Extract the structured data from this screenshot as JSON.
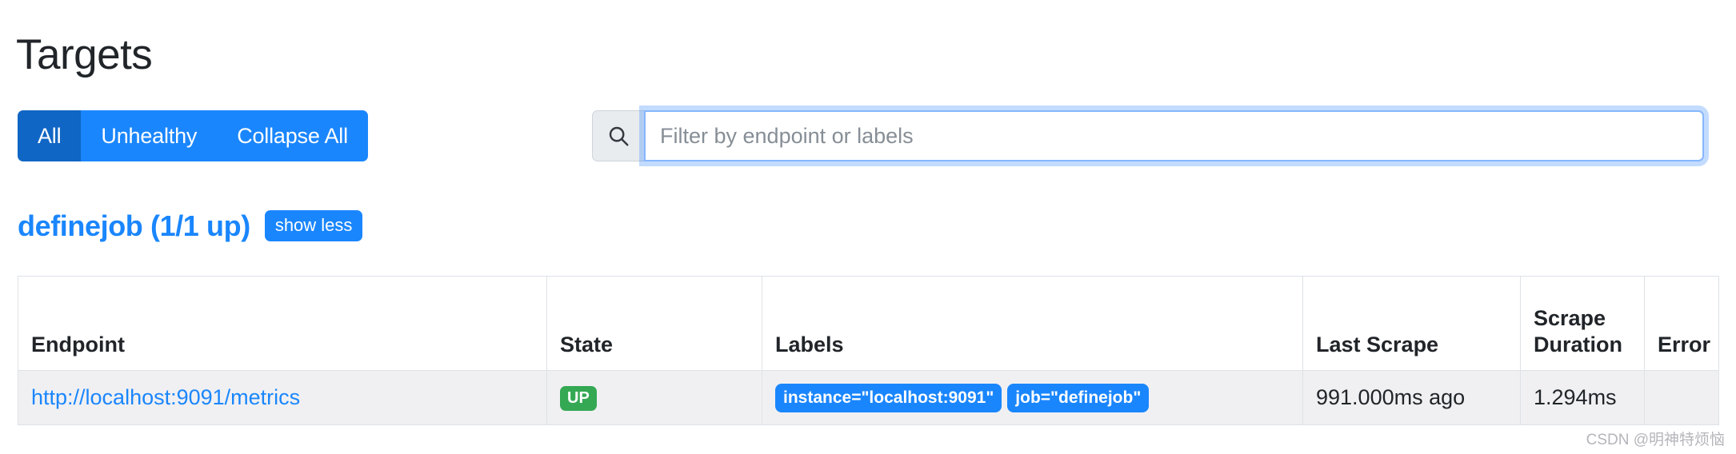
{
  "page": {
    "title": "Targets"
  },
  "toolbar": {
    "buttons": [
      {
        "label": "All",
        "active": true
      },
      {
        "label": "Unhealthy",
        "active": false
      },
      {
        "label": "Collapse All",
        "active": false
      }
    ],
    "search": {
      "icon": "search-icon",
      "placeholder": "Filter by endpoint or labels",
      "value": ""
    },
    "colors": {
      "active_button": "#1066c4",
      "button": "#1a86fd",
      "focus_ring": "#86b7fe"
    }
  },
  "job": {
    "title": "definejob (1/1 up)",
    "toggle_label": "show less",
    "color": "#1a86fd"
  },
  "table": {
    "headers": [
      "Endpoint",
      "State",
      "Labels",
      "Last Scrape",
      "Scrape Duration",
      "Error"
    ],
    "rows": [
      {
        "endpoint": "http://localhost:9091/metrics",
        "state": "UP",
        "state_color": "#34a853",
        "labels": [
          "instance=\"localhost:9091\"",
          "job=\"definejob\""
        ],
        "last_scrape": "991.000ms ago",
        "scrape_duration": "1.294ms",
        "error": ""
      }
    ]
  },
  "watermark": {
    "text": "CSDN @明神特烦恼"
  }
}
